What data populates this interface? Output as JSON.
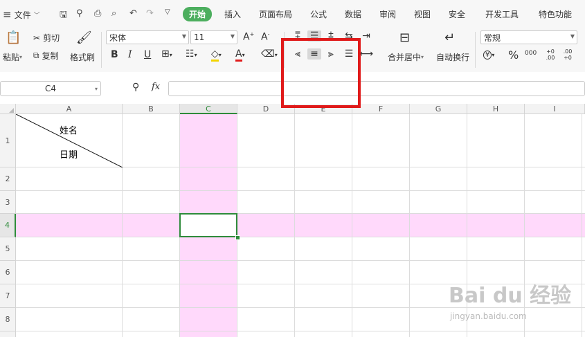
{
  "menu": {
    "hamburger": "≡",
    "file": "文件"
  },
  "tabs": [
    {
      "label": "开始",
      "active": true
    },
    {
      "label": "插入"
    },
    {
      "label": "页面布局"
    },
    {
      "label": "公式"
    },
    {
      "label": "数据"
    },
    {
      "label": "审阅"
    },
    {
      "label": "视图"
    },
    {
      "label": "安全"
    },
    {
      "label": "开发工具"
    },
    {
      "label": "特色功能"
    }
  ],
  "ribbon": {
    "paste": "粘贴",
    "cut": "剪切",
    "copy": "复制",
    "format_painter": "格式刷",
    "font_name": "宋体",
    "font_size": "11",
    "bold": "B",
    "italic": "I",
    "underline": "U",
    "merge_center": "合并居中",
    "wrap_text": "自动换行",
    "number_format": "常规",
    "currency": "¥",
    "percent": "%",
    "thousands": "000",
    "inc_decimal": "+0 .00",
    "dec_decimal": ".00 +0"
  },
  "formula_bar": {
    "name_box": "C4",
    "fx": "fx",
    "zoom_icon": "search-icon"
  },
  "sheet": {
    "columns": [
      "A",
      "B",
      "C",
      "D",
      "E",
      "F",
      "G",
      "H",
      "I"
    ],
    "rows": [
      "1",
      "2",
      "3",
      "4",
      "5",
      "6",
      "7",
      "8"
    ],
    "a1_top": "姓名",
    "a1_bottom": "日期",
    "selected_cell": "C4"
  },
  "watermark": {
    "main": "Bai du 经验",
    "sub": "jingyan.baidu.com"
  },
  "colors": {
    "accent": "#4cae5e",
    "highlight": "#ffd9fb",
    "selection": "#2e8b3a",
    "annotation": "#e01a1a"
  }
}
